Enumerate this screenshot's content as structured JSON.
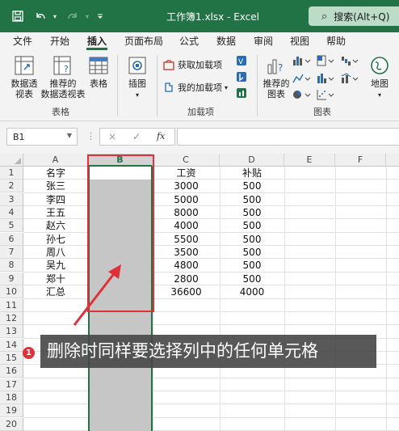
{
  "titlebar": {
    "title": "工作簿1.xlsx  -  Excel",
    "search_label": "搜索(Alt+Q)",
    "icons": [
      "save-icon",
      "undo-icon",
      "redo-icon",
      "customize-icon"
    ]
  },
  "tabs": [
    "文件",
    "开始",
    "插入",
    "页面布局",
    "公式",
    "数据",
    "审阅",
    "视图",
    "帮助"
  ],
  "active_tab": "插入",
  "ribbon": {
    "pivot_table_label_1": "数据透",
    "pivot_table_label_2": "视表",
    "recommended_pivot_label_1": "推荐的",
    "recommended_pivot_label_2": "数据透视表",
    "table_label": "表格",
    "group_tables": "表格",
    "illustrations_label": "插图",
    "get_addins_label": "获取加载项",
    "my_addins_label": "我的加载项",
    "group_addins": "加载项",
    "recommended_charts_label_1": "推荐的",
    "recommended_charts_label_2": "图表",
    "group_charts": "图表",
    "map_label": "地图"
  },
  "formula_bar": {
    "name_box": "B1",
    "cancel_symbol": "×",
    "enter_symbol": "✓",
    "fx_symbol": "fx",
    "formula": ""
  },
  "columns": [
    "A",
    "B",
    "C",
    "D",
    "E",
    "F"
  ],
  "selected_column": "B",
  "rows": [
    "1",
    "2",
    "3",
    "4",
    "5",
    "6",
    "7",
    "8",
    "9",
    "10",
    "11",
    "12",
    "13",
    "14",
    "15",
    "16",
    "17",
    "18",
    "19",
    "20"
  ],
  "table": [
    {
      "a": "名字",
      "c": "工资",
      "d": "补贴"
    },
    {
      "a": "张三",
      "c": "3000",
      "d": "500"
    },
    {
      "a": "李四",
      "c": "5000",
      "d": "500"
    },
    {
      "a": "王五",
      "c": "8000",
      "d": "500"
    },
    {
      "a": "赵六",
      "c": "4000",
      "d": "500"
    },
    {
      "a": "孙七",
      "c": "5500",
      "d": "500"
    },
    {
      "a": "周八",
      "c": "3500",
      "d": "500"
    },
    {
      "a": "吴九",
      "c": "4800",
      "d": "500"
    },
    {
      "a": "郑十",
      "c": "2800",
      "d": "500"
    },
    {
      "a": "汇总",
      "c": "36600",
      "d": "4000"
    }
  ],
  "annotation": {
    "badge": "1",
    "text": "删除时同样要选择列中的任何单元格"
  },
  "colors": {
    "accent": "#217346",
    "highlight": "#e0303a",
    "selection": "#c6c6c6"
  }
}
